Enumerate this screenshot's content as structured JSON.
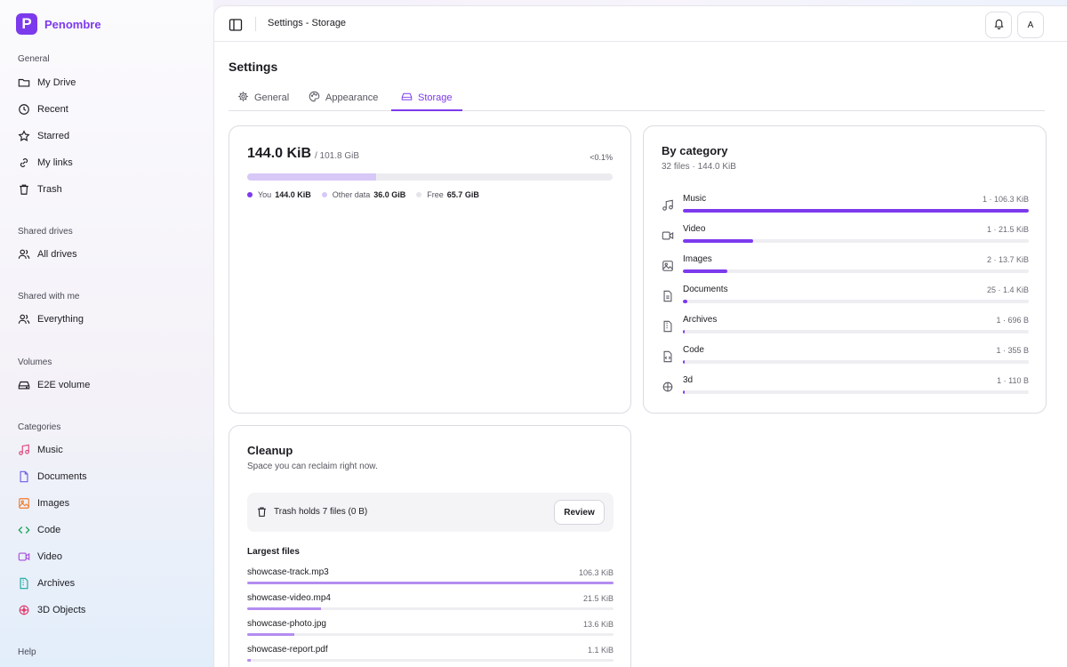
{
  "brand": {
    "logo_letter": "P",
    "name": "Penombre",
    "accent": "#7c3aed"
  },
  "sidebar": {
    "general_label": "General",
    "general": [
      {
        "label": "My Drive",
        "icon": "folder-icon"
      },
      {
        "label": "Recent",
        "icon": "history-icon"
      },
      {
        "label": "Starred",
        "icon": "star-icon"
      },
      {
        "label": "My links",
        "icon": "link-icon"
      },
      {
        "label": "Trash",
        "icon": "trash-icon"
      }
    ],
    "shared_drives_label": "Shared drives",
    "shared_drives": [
      {
        "label": "All drives",
        "icon": "users-icon"
      }
    ],
    "shared_with_me_label": "Shared with me",
    "shared_with_me": [
      {
        "label": "Everything",
        "icon": "users-icon"
      }
    ],
    "volumes_label": "Volumes",
    "volumes": [
      {
        "label": "E2E volume",
        "icon": "drive-icon"
      }
    ],
    "categories_label": "Categories",
    "categories": [
      {
        "label": "Music",
        "icon": "music-icon",
        "color": "#e0457b"
      },
      {
        "label": "Documents",
        "icon": "document-icon",
        "color": "#6b5ce7"
      },
      {
        "label": "Images",
        "icon": "image-icon",
        "color": "#f07a2a"
      },
      {
        "label": "Code",
        "icon": "code-icon",
        "color": "#1fa35a"
      },
      {
        "label": "Video",
        "icon": "video-icon",
        "color": "#a64be0"
      },
      {
        "label": "Archives",
        "icon": "archive-icon",
        "color": "#18a7a0"
      },
      {
        "label": "3D Objects",
        "icon": "cube-icon",
        "color": "#e23a6a"
      }
    ],
    "help_label": "Help"
  },
  "topbar": {
    "breadcrumb": "Settings - Storage",
    "avatar_letter": "A"
  },
  "page": {
    "title": "Settings"
  },
  "tabs": [
    {
      "label": "General",
      "icon": "gear-icon"
    },
    {
      "label": "Appearance",
      "icon": "palette-icon"
    },
    {
      "label": "Storage",
      "icon": "drive-icon",
      "active": true
    }
  ],
  "usage": {
    "used": "144.0 KiB",
    "total": "/ 101.8 GiB",
    "percent_label": "<0.1%",
    "other_fraction": 0.354,
    "legend": [
      {
        "label": "You",
        "value": "144.0 KiB",
        "color": "#7c3aed"
      },
      {
        "label": "Other data",
        "value": "36.0 GiB",
        "color": "#d7c8f7"
      },
      {
        "label": "Free",
        "value": "65.7 GiB",
        "color": "#e4e4ea"
      }
    ]
  },
  "by_category": {
    "title": "By category",
    "subtitle": "32 files · 144.0 KiB",
    "rows": [
      {
        "name": "Music",
        "value": "1 · 106.3 KiB",
        "fraction": 1.0,
        "icon": "music-icon"
      },
      {
        "name": "Video",
        "value": "1 · 21.5 KiB",
        "fraction": 0.202,
        "icon": "video-icon"
      },
      {
        "name": "Images",
        "value": "2 · 13.7 KiB",
        "fraction": 0.129,
        "icon": "image-icon"
      },
      {
        "name": "Documents",
        "value": "25 · 1.4 KiB",
        "fraction": 0.013,
        "icon": "document-icon"
      },
      {
        "name": "Archives",
        "value": "1 · 696 B",
        "fraction": 0.006,
        "icon": "archive-icon"
      },
      {
        "name": "Code",
        "value": "1 · 355 B",
        "fraction": 0.003,
        "icon": "code-file-icon"
      },
      {
        "name": "3d",
        "value": "1 · 110 B",
        "fraction": 0.001,
        "icon": "cube-icon"
      }
    ]
  },
  "cleanup": {
    "title": "Cleanup",
    "subtitle": "Space you can reclaim right now.",
    "trash_text": "Trash holds 7 files (0 B)",
    "review_label": "Review",
    "largest_title": "Largest files",
    "files": [
      {
        "name": "showcase-track.mp3",
        "size": "106.3 KiB",
        "fraction": 1.0
      },
      {
        "name": "showcase-video.mp4",
        "size": "21.5 KiB",
        "fraction": 0.202
      },
      {
        "name": "showcase-photo.jpg",
        "size": "13.6 KiB",
        "fraction": 0.128
      },
      {
        "name": "showcase-report.pdf",
        "size": "1.1 KiB",
        "fraction": 0.01
      }
    ]
  }
}
